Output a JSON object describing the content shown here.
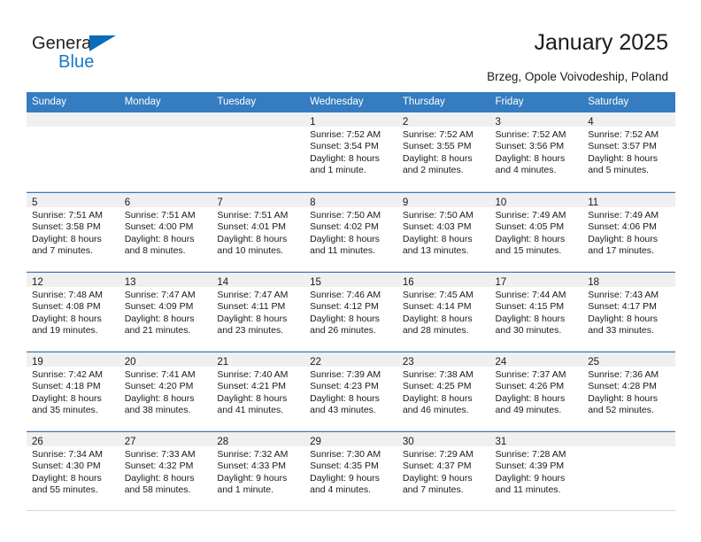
{
  "brand": {
    "name_top": "General",
    "name_bottom": "Blue",
    "triangle_icon": "triangle-icon",
    "color_dark": "#231f20",
    "color_blue": "#1878c8"
  },
  "header": {
    "title": "January 2025",
    "subtitle": "Brzeg, Opole Voivodeship, Poland"
  },
  "theme": {
    "header_blue": "#357cc0",
    "daynum_band": "#f0f0f0",
    "cell_border": "#d9d9d9"
  },
  "calendar": {
    "weekday_headers": [
      "Sunday",
      "Monday",
      "Tuesday",
      "Wednesday",
      "Thursday",
      "Friday",
      "Saturday"
    ],
    "weeks": [
      [
        {
          "day": "",
          "lines": []
        },
        {
          "day": "",
          "lines": []
        },
        {
          "day": "",
          "lines": []
        },
        {
          "day": "1",
          "lines": [
            "Sunrise: 7:52 AM",
            "Sunset: 3:54 PM",
            "Daylight: 8 hours",
            "and 1 minute."
          ]
        },
        {
          "day": "2",
          "lines": [
            "Sunrise: 7:52 AM",
            "Sunset: 3:55 PM",
            "Daylight: 8 hours",
            "and 2 minutes."
          ]
        },
        {
          "day": "3",
          "lines": [
            "Sunrise: 7:52 AM",
            "Sunset: 3:56 PM",
            "Daylight: 8 hours",
            "and 4 minutes."
          ]
        },
        {
          "day": "4",
          "lines": [
            "Sunrise: 7:52 AM",
            "Sunset: 3:57 PM",
            "Daylight: 8 hours",
            "and 5 minutes."
          ]
        }
      ],
      [
        {
          "day": "5",
          "lines": [
            "Sunrise: 7:51 AM",
            "Sunset: 3:58 PM",
            "Daylight: 8 hours",
            "and 7 minutes."
          ]
        },
        {
          "day": "6",
          "lines": [
            "Sunrise: 7:51 AM",
            "Sunset: 4:00 PM",
            "Daylight: 8 hours",
            "and 8 minutes."
          ]
        },
        {
          "day": "7",
          "lines": [
            "Sunrise: 7:51 AM",
            "Sunset: 4:01 PM",
            "Daylight: 8 hours",
            "and 10 minutes."
          ]
        },
        {
          "day": "8",
          "lines": [
            "Sunrise: 7:50 AM",
            "Sunset: 4:02 PM",
            "Daylight: 8 hours",
            "and 11 minutes."
          ]
        },
        {
          "day": "9",
          "lines": [
            "Sunrise: 7:50 AM",
            "Sunset: 4:03 PM",
            "Daylight: 8 hours",
            "and 13 minutes."
          ]
        },
        {
          "day": "10",
          "lines": [
            "Sunrise: 7:49 AM",
            "Sunset: 4:05 PM",
            "Daylight: 8 hours",
            "and 15 minutes."
          ]
        },
        {
          "day": "11",
          "lines": [
            "Sunrise: 7:49 AM",
            "Sunset: 4:06 PM",
            "Daylight: 8 hours",
            "and 17 minutes."
          ]
        }
      ],
      [
        {
          "day": "12",
          "lines": [
            "Sunrise: 7:48 AM",
            "Sunset: 4:08 PM",
            "Daylight: 8 hours",
            "and 19 minutes."
          ]
        },
        {
          "day": "13",
          "lines": [
            "Sunrise: 7:47 AM",
            "Sunset: 4:09 PM",
            "Daylight: 8 hours",
            "and 21 minutes."
          ]
        },
        {
          "day": "14",
          "lines": [
            "Sunrise: 7:47 AM",
            "Sunset: 4:11 PM",
            "Daylight: 8 hours",
            "and 23 minutes."
          ]
        },
        {
          "day": "15",
          "lines": [
            "Sunrise: 7:46 AM",
            "Sunset: 4:12 PM",
            "Daylight: 8 hours",
            "and 26 minutes."
          ]
        },
        {
          "day": "16",
          "lines": [
            "Sunrise: 7:45 AM",
            "Sunset: 4:14 PM",
            "Daylight: 8 hours",
            "and 28 minutes."
          ]
        },
        {
          "day": "17",
          "lines": [
            "Sunrise: 7:44 AM",
            "Sunset: 4:15 PM",
            "Daylight: 8 hours",
            "and 30 minutes."
          ]
        },
        {
          "day": "18",
          "lines": [
            "Sunrise: 7:43 AM",
            "Sunset: 4:17 PM",
            "Daylight: 8 hours",
            "and 33 minutes."
          ]
        }
      ],
      [
        {
          "day": "19",
          "lines": [
            "Sunrise: 7:42 AM",
            "Sunset: 4:18 PM",
            "Daylight: 8 hours",
            "and 35 minutes."
          ]
        },
        {
          "day": "20",
          "lines": [
            "Sunrise: 7:41 AM",
            "Sunset: 4:20 PM",
            "Daylight: 8 hours",
            "and 38 minutes."
          ]
        },
        {
          "day": "21",
          "lines": [
            "Sunrise: 7:40 AM",
            "Sunset: 4:21 PM",
            "Daylight: 8 hours",
            "and 41 minutes."
          ]
        },
        {
          "day": "22",
          "lines": [
            "Sunrise: 7:39 AM",
            "Sunset: 4:23 PM",
            "Daylight: 8 hours",
            "and 43 minutes."
          ]
        },
        {
          "day": "23",
          "lines": [
            "Sunrise: 7:38 AM",
            "Sunset: 4:25 PM",
            "Daylight: 8 hours",
            "and 46 minutes."
          ]
        },
        {
          "day": "24",
          "lines": [
            "Sunrise: 7:37 AM",
            "Sunset: 4:26 PM",
            "Daylight: 8 hours",
            "and 49 minutes."
          ]
        },
        {
          "day": "25",
          "lines": [
            "Sunrise: 7:36 AM",
            "Sunset: 4:28 PM",
            "Daylight: 8 hours",
            "and 52 minutes."
          ]
        }
      ],
      [
        {
          "day": "26",
          "lines": [
            "Sunrise: 7:34 AM",
            "Sunset: 4:30 PM",
            "Daylight: 8 hours",
            "and 55 minutes."
          ]
        },
        {
          "day": "27",
          "lines": [
            "Sunrise: 7:33 AM",
            "Sunset: 4:32 PM",
            "Daylight: 8 hours",
            "and 58 minutes."
          ]
        },
        {
          "day": "28",
          "lines": [
            "Sunrise: 7:32 AM",
            "Sunset: 4:33 PM",
            "Daylight: 9 hours",
            "and 1 minute."
          ]
        },
        {
          "day": "29",
          "lines": [
            "Sunrise: 7:30 AM",
            "Sunset: 4:35 PM",
            "Daylight: 9 hours",
            "and 4 minutes."
          ]
        },
        {
          "day": "30",
          "lines": [
            "Sunrise: 7:29 AM",
            "Sunset: 4:37 PM",
            "Daylight: 9 hours",
            "and 7 minutes."
          ]
        },
        {
          "day": "31",
          "lines": [
            "Sunrise: 7:28 AM",
            "Sunset: 4:39 PM",
            "Daylight: 9 hours",
            "and 11 minutes."
          ]
        },
        {
          "day": "",
          "lines": []
        }
      ]
    ]
  }
}
